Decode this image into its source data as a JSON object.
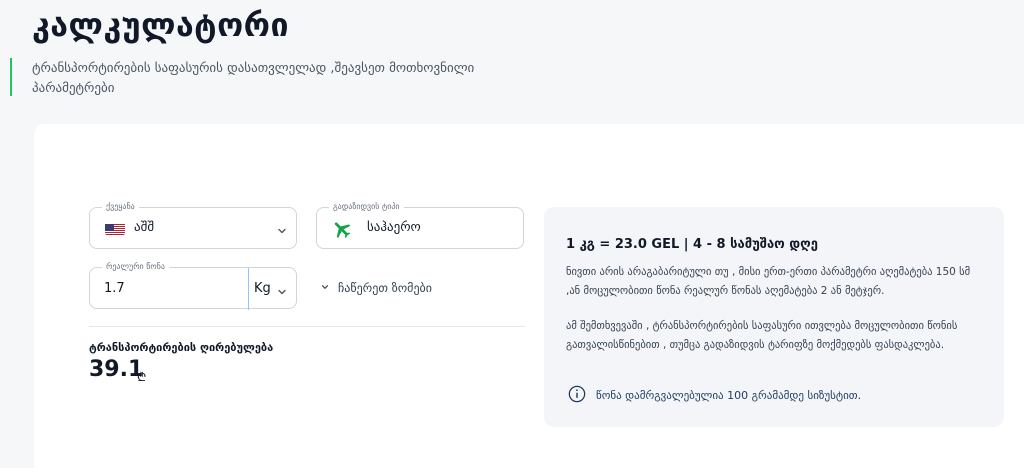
{
  "page": {
    "title": "კალკულატორი",
    "subtitle": "ტრანსპორტირების საფასურის დასათვლელად ,შეავსეთ მოთხოვნილი პარამეტრები"
  },
  "form": {
    "country": {
      "label": "ქვეყანა",
      "value": "აშშ",
      "flag_icon": "us-flag-icon"
    },
    "transport": {
      "label": "გადაზიდვის ტიპი",
      "value": "საჰაერო",
      "icon": "airplane-icon"
    },
    "weight": {
      "label": "რეალური წონა",
      "value": "1.7",
      "unit": "Kg"
    },
    "dimensions_toggle": "ჩაწერეთ ზომები",
    "cost_label": "ტრანსპორტირების ღირებულება",
    "cost_value": "39.1",
    "cost_currency": "₾"
  },
  "info": {
    "title": "1 კგ = 23.0 GEL | 4 - 8 სამუშაო დღე",
    "para1": "ნივთი არის არაგაბარიტული თუ , მისი ერთ-ერთი პარამეტრი აღემატება 150 სმ ,ან მოცულობითი წონა რეალურ წონას აღემატება 2 ან მეტჯერ.",
    "para2": "ამ შემთხვევაში , ტრანსპორტირების საფასური ითვლება მოცულობითი წონის გათვალისწინებით , თუმცა გადაზიდვის ტარიფზე მოქმედებს ფასდაკლება.",
    "note": "წონა დამრგვალებულია 100 გრამამდე სიზუსტით."
  },
  "colors": {
    "accent_green": "#22c55e",
    "plane_green": "#16a34a",
    "focus_blue": "#93c5fd",
    "info_bg": "#f3f5f8"
  }
}
